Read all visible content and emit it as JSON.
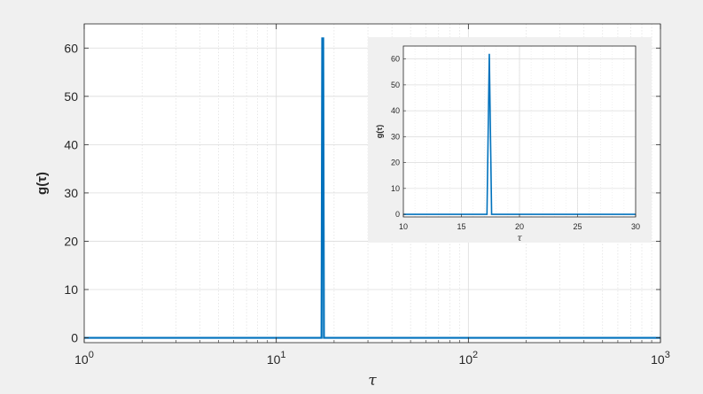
{
  "chart_data": [
    {
      "type": "line",
      "xscale": "log",
      "xlim": [
        1,
        1000
      ],
      "ylim": [
        -1,
        65
      ],
      "grid": true,
      "xlabel": "τ",
      "ylabel": "g(τ)",
      "xticks": [
        "10^0",
        "10^1",
        "10^2",
        "10^3"
      ],
      "xtick_base": "10",
      "xtick_exp": [
        "0",
        "1",
        "2",
        "3"
      ],
      "yticks": [
        "0",
        "10",
        "20",
        "30",
        "40",
        "50",
        "60"
      ],
      "series": [
        {
          "x": [
            1,
            17.2,
            17.35,
            17.55,
            17.7,
            1000
          ],
          "y": [
            0,
            0,
            62,
            62,
            0,
            0
          ]
        }
      ],
      "line_color": "#0072BD"
    },
    {
      "type": "line",
      "xscale": "linear",
      "xlim": [
        10,
        30
      ],
      "ylim": [
        -1,
        65
      ],
      "grid": true,
      "xlabel": "τ",
      "ylabel": "g(τ)",
      "xticks": [
        "10",
        "15",
        "20",
        "25",
        "30"
      ],
      "yticks": [
        "0",
        "10",
        "20",
        "30",
        "40",
        "50",
        "60"
      ],
      "series": [
        {
          "x": [
            10,
            17.2,
            17.4,
            17.6,
            30
          ],
          "y": [
            0,
            0,
            62,
            0,
            0
          ]
        }
      ],
      "line_color": "#0072BD"
    }
  ]
}
